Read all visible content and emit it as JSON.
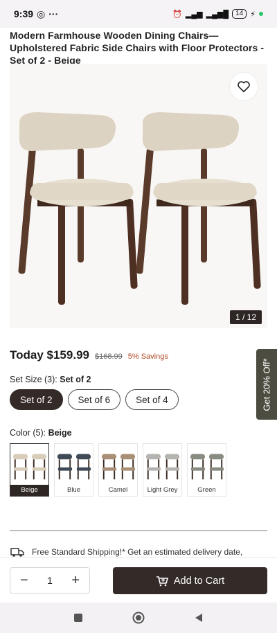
{
  "status": {
    "time": "9:39",
    "battery": "14"
  },
  "product": {
    "title": "Modern Farmhouse Wooden Dining Chairs—Upholstered Fabric Side Chairs with Floor Protectors - Set of 2 - Beige",
    "image_counter": "1 / 12",
    "price_today": "Today $159.99",
    "price_old": "$168.99",
    "savings": "5% Savings",
    "promo_tab": "Get 20% Off*"
  },
  "set_size": {
    "label": "Set Size (3):",
    "selected": "Set of 2",
    "options": [
      "Set of 2",
      "Set of 6",
      "Set of 4"
    ]
  },
  "color": {
    "label": "Color (5):",
    "selected": "Beige",
    "options": [
      {
        "name": "Beige",
        "hex": "#d8cdb9"
      },
      {
        "name": "Blue",
        "hex": "#3f4a56"
      },
      {
        "name": "Camel",
        "hex": "#a88f76"
      },
      {
        "name": "Light Grey",
        "hex": "#b5b3af"
      },
      {
        "name": "Green",
        "hex": "#878b80"
      }
    ]
  },
  "shipping": {
    "text": "Free Standard Shipping!* Get an estimated delivery date,"
  },
  "cart": {
    "quantity": "1",
    "add_label": "Add to Cart"
  },
  "colors": {
    "primary": "#342a28",
    "savings": "#b04a23",
    "promo": "#4d4c40"
  }
}
